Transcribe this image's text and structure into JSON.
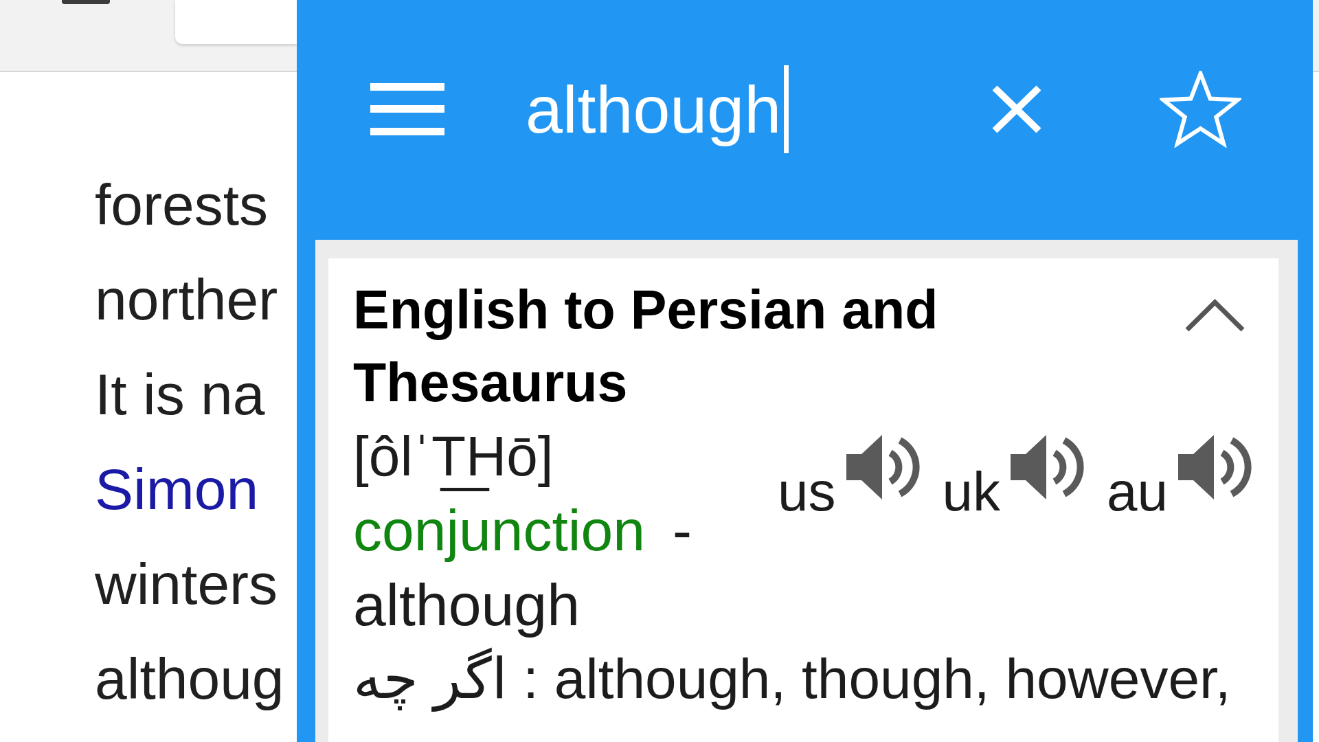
{
  "page": {
    "lines": [
      {
        "kind": "text",
        "text": "forests"
      },
      {
        "kind": "text",
        "text": "norther"
      },
      {
        "kind": "text",
        "text": "It is na"
      },
      {
        "kind": "link",
        "text": "Simon"
      },
      {
        "kind": "text",
        "text": "winters"
      },
      {
        "kind": "text",
        "text": "althoug"
      }
    ]
  },
  "popup": {
    "search": {
      "value": "although"
    },
    "result": {
      "title": "English to Persian and Thesaurus",
      "expanded": true,
      "pronunciation": "[ôlˈT͟Hō]",
      "audio": [
        {
          "label": "us"
        },
        {
          "label": "uk"
        },
        {
          "label": "au"
        }
      ],
      "part_of_speech": "conjunction",
      "separator": "-",
      "headword": "although",
      "translation": "اگر چه : although, though, however,"
    }
  }
}
